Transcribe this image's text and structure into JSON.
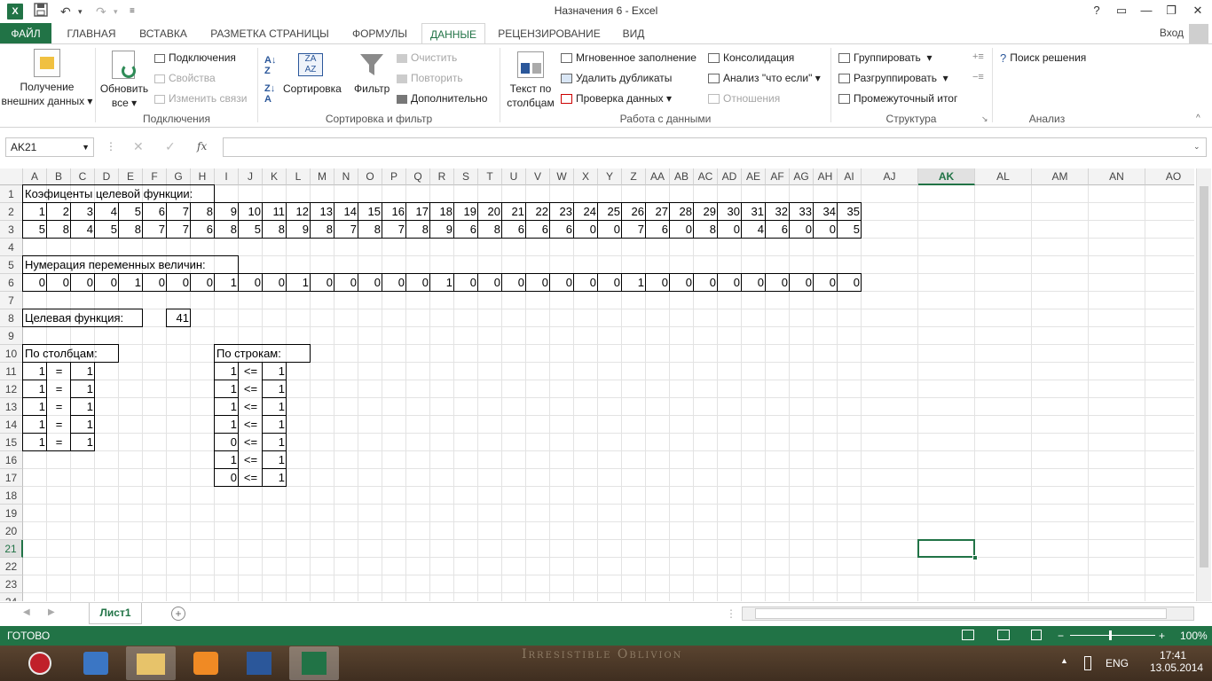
{
  "window": {
    "title": "Назначения 6 - Excel",
    "help": "?",
    "login": "Вход"
  },
  "tabs": [
    "ФАЙЛ",
    "ГЛАВНАЯ",
    "ВСТАВКА",
    "РАЗМЕТКА СТРАНИЦЫ",
    "ФОРМУЛЫ",
    "ДАННЫЕ",
    "РЕЦЕНЗИРОВАНИЕ",
    "ВИД"
  ],
  "ribbon": {
    "get_external_1": "Получение",
    "get_external_2": "внешних данных",
    "refresh_1": "Обновить",
    "refresh_2": "все",
    "connections": "Подключения",
    "properties": "Свойства",
    "edit_links": "Изменить связи",
    "group_connections": "Подключения",
    "sort": "Сортировка",
    "filter": "Фильтр",
    "clear": "Очистить",
    "reapply": "Повторить",
    "advanced": "Дополнительно",
    "group_sort": "Сортировка и фильтр",
    "text_to_cols_1": "Текст по",
    "text_to_cols_2": "столбцам",
    "flash_fill": "Мгновенное заполнение",
    "remove_dup": "Удалить дубликаты",
    "validation": "Проверка данных",
    "consolidate": "Консолидация",
    "whatif": "Анализ \"что если\"",
    "relations": "Отношения",
    "group_data": "Работа с данными",
    "group_btn": "Группировать",
    "ungroup_btn": "Разгруппировать",
    "subtotal": "Промежуточный итог",
    "group_structure": "Структура",
    "solver": "Поиск решения",
    "group_analysis": "Анализ"
  },
  "formula_bar": {
    "name_box": "AK21",
    "fx": "fx",
    "value": ""
  },
  "columns": [
    "A",
    "B",
    "C",
    "D",
    "E",
    "F",
    "G",
    "H",
    "I",
    "J",
    "K",
    "L",
    "M",
    "N",
    "O",
    "P",
    "Q",
    "R",
    "S",
    "T",
    "U",
    "V",
    "W",
    "X",
    "Y",
    "Z",
    "AA",
    "AB",
    "AC",
    "AD",
    "AE",
    "AF",
    "AG",
    "AH",
    "AI",
    "AJ",
    "AK",
    "AL",
    "AM",
    "AN",
    "AO"
  ],
  "rows": [
    "1",
    "2",
    "3",
    "4",
    "5",
    "6",
    "7",
    "8",
    "9",
    "10",
    "11",
    "12",
    "13",
    "14",
    "15",
    "16",
    "17",
    "18",
    "19",
    "20",
    "21",
    "22",
    "23",
    "24"
  ],
  "sheet": {
    "label_coef": "Коэфиценты целевой функции:",
    "row2": [
      1,
      2,
      3,
      4,
      5,
      6,
      7,
      8,
      9,
      10,
      11,
      12,
      13,
      14,
      15,
      16,
      17,
      18,
      19,
      20,
      21,
      22,
      23,
      24,
      25,
      26,
      27,
      28,
      29,
      30,
      31,
      32,
      33,
      34,
      35
    ],
    "row3": [
      5,
      8,
      4,
      5,
      8,
      7,
      7,
      6,
      8,
      5,
      8,
      9,
      8,
      7,
      8,
      7,
      8,
      9,
      6,
      8,
      6,
      6,
      6,
      0,
      0,
      7,
      6,
      0,
      8,
      0,
      4,
      6,
      0,
      0,
      5
    ],
    "label_vars": "Нумерация переменных величин:",
    "row6": [
      0,
      0,
      0,
      0,
      1,
      0,
      0,
      0,
      1,
      0,
      0,
      1,
      0,
      0,
      0,
      0,
      0,
      1,
      0,
      0,
      0,
      0,
      0,
      0,
      0,
      1,
      0,
      0,
      0,
      0,
      0,
      0,
      0,
      0,
      0
    ],
    "label_target": "Целевая функция:",
    "target_value": "41",
    "label_cols": "По столбцам:",
    "cols_constraints": [
      [
        "1",
        "=",
        "1"
      ],
      [
        "1",
        "=",
        "1"
      ],
      [
        "1",
        "=",
        "1"
      ],
      [
        "1",
        "=",
        "1"
      ],
      [
        "1",
        "=",
        "1"
      ]
    ],
    "label_rows": "По строкам:",
    "rows_constraints": [
      [
        "1",
        "<=",
        "1"
      ],
      [
        "1",
        "<=",
        "1"
      ],
      [
        "1",
        "<=",
        "1"
      ],
      [
        "1",
        "<=",
        "1"
      ],
      [
        "0",
        "<=",
        "1"
      ],
      [
        "1",
        "<=",
        "1"
      ],
      [
        "0",
        "<=",
        "1"
      ]
    ]
  },
  "sheet_tab": "Лист1",
  "status": {
    "ready": "ГОТОВО",
    "zoom": "100%"
  },
  "taskbar": {
    "lang": "ENG",
    "time": "17:41",
    "date": "13.05.2014",
    "wallpaper_text": "Irresistible Oblivion"
  },
  "colors": {
    "accent": "#217346",
    "taskbar": "#4a3626"
  }
}
